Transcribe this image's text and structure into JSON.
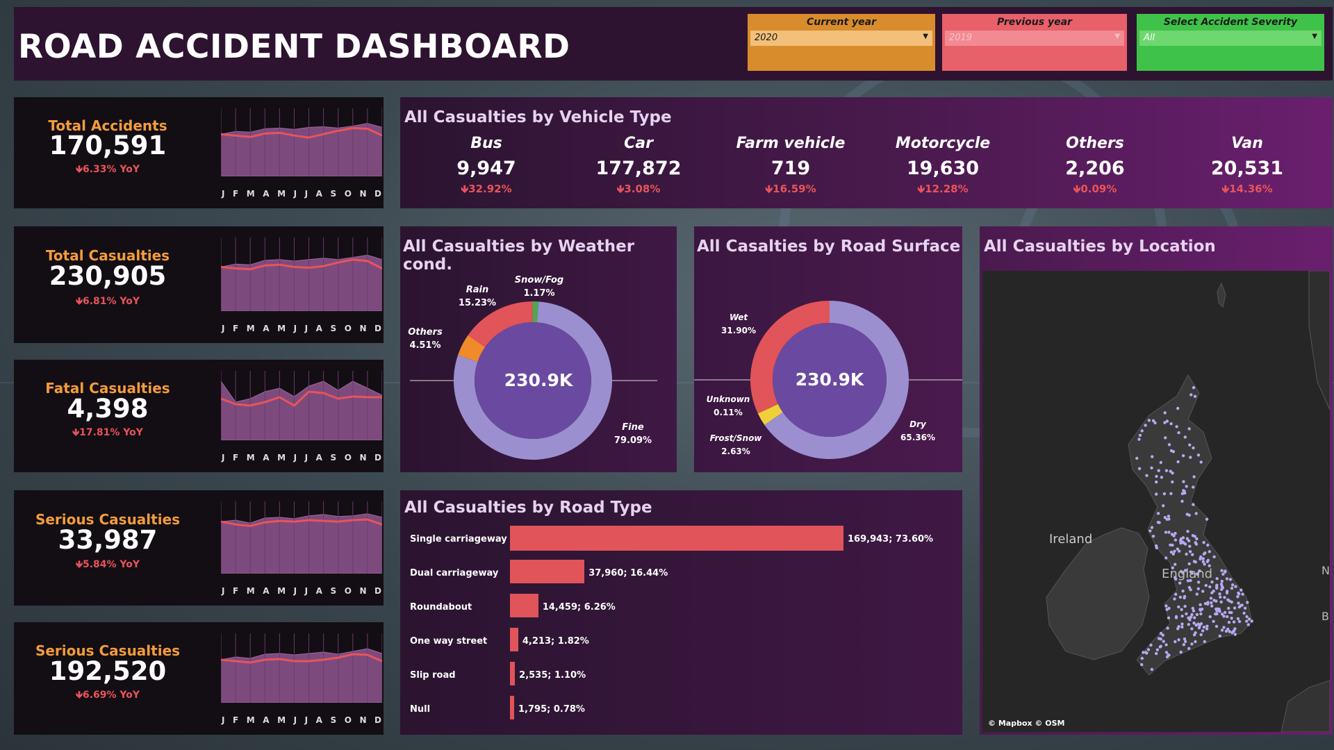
{
  "header": {
    "title": "ROAD ACCIDENT DASHBOARD"
  },
  "filters": [
    {
      "label": "Current year",
      "value": "2020",
      "color": "#d98c2b",
      "selcolor": "#f2c07a"
    },
    {
      "label": "Previous year",
      "value": "2019",
      "color": "#e8606a",
      "selcolor": "#f28a92"
    },
    {
      "label": "Select Accident Severity",
      "value": "All",
      "color": "#3fc24a",
      "selcolor": "#6fd76f"
    }
  ],
  "kpis": [
    {
      "title": "Total Accidents",
      "value": "170,591",
      "yoy": "🡻6.33% YoY",
      "area": [
        0.62,
        0.66,
        0.65,
        0.7,
        0.71,
        0.69,
        0.72,
        0.73,
        0.71,
        0.74,
        0.78,
        0.72
      ],
      "line": [
        0.62,
        0.6,
        0.58,
        0.63,
        0.64,
        0.6,
        0.57,
        0.62,
        0.67,
        0.71,
        0.7,
        0.6
      ]
    },
    {
      "title": "Total Casualties",
      "value": "230,905",
      "yoy": "🡻6.81% YoY",
      "area": [
        0.6,
        0.64,
        0.63,
        0.69,
        0.7,
        0.68,
        0.7,
        0.72,
        0.7,
        0.73,
        0.76,
        0.7
      ],
      "line": [
        0.6,
        0.58,
        0.57,
        0.62,
        0.63,
        0.6,
        0.59,
        0.61,
        0.66,
        0.7,
        0.68,
        0.58
      ]
    },
    {
      "title": "Fatal Casualties",
      "value": "4,398",
      "yoy": "🡻17.81% YoY",
      "area": [
        0.85,
        0.55,
        0.6,
        0.7,
        0.75,
        0.63,
        0.78,
        0.85,
        0.72,
        0.85,
        0.75,
        0.65
      ],
      "line": [
        0.6,
        0.52,
        0.5,
        0.55,
        0.62,
        0.5,
        0.7,
        0.68,
        0.6,
        0.63,
        0.62,
        0.62
      ]
    },
    {
      "title": "Serious Casualties",
      "value": "33,987",
      "yoy": "🡻5.84% YoY",
      "area": [
        0.72,
        0.74,
        0.7,
        0.77,
        0.78,
        0.76,
        0.8,
        0.82,
        0.79,
        0.8,
        0.83,
        0.78
      ],
      "line": [
        0.72,
        0.68,
        0.66,
        0.71,
        0.73,
        0.72,
        0.74,
        0.73,
        0.72,
        0.74,
        0.75,
        0.68
      ]
    },
    {
      "title": "Serious Casualties",
      "value": "192,520",
      "yoy": "🡻6.69% YoY",
      "area": [
        0.62,
        0.66,
        0.64,
        0.7,
        0.71,
        0.69,
        0.71,
        0.73,
        0.7,
        0.74,
        0.78,
        0.71
      ],
      "line": [
        0.62,
        0.6,
        0.58,
        0.62,
        0.63,
        0.6,
        0.6,
        0.62,
        0.65,
        0.7,
        0.69,
        0.6
      ]
    }
  ],
  "months": [
    "J",
    "F",
    "M",
    "A",
    "M",
    "J",
    "J",
    "A",
    "S",
    "O",
    "N",
    "D"
  ],
  "vehicle": {
    "title": "All Casualties by Vehicle Type",
    "items": [
      {
        "name": "Bus",
        "value": "9,947",
        "change": "🡻32.92%"
      },
      {
        "name": "Car",
        "value": "177,872",
        "change": "🡻3.08%"
      },
      {
        "name": "Farm vehicle",
        "value": "719",
        "change": "🡻16.59%"
      },
      {
        "name": "Motorcycle",
        "value": "19,630",
        "change": "🡻12.28%"
      },
      {
        "name": "Others",
        "value": "2,206",
        "change": "🡻0.09%"
      },
      {
        "name": "Van",
        "value": "20,531",
        "change": "🡻14.36%"
      }
    ]
  },
  "weather": {
    "title": "All Casualties by Weather cond.",
    "center": "230.9K",
    "slices": [
      {
        "name": "Fine",
        "pct": "79.09%",
        "value": 79.09,
        "color": "#9b8fd0"
      },
      {
        "name": "Others",
        "pct": "4.51%",
        "value": 4.51,
        "color": "#f08a2a"
      },
      {
        "name": "Rain",
        "pct": "15.23%",
        "value": 15.23,
        "color": "#e0545a"
      },
      {
        "name": "Snow/Fog",
        "pct": "1.17%",
        "value": 1.17,
        "color": "#4fa84f"
      }
    ]
  },
  "surface": {
    "title": "All Casaltiesi by Road Surface",
    "center": "230.9K",
    "slices": [
      {
        "name": "Dry",
        "pct": "65.36%",
        "value": 65.36,
        "color": "#9b8fd0"
      },
      {
        "name": "Frost/Snow",
        "pct": "2.63%",
        "value": 2.63,
        "color": "#f0d03a"
      },
      {
        "name": "Unknown",
        "pct": "0.11%",
        "value": 0.11,
        "color": "#f08a2a"
      },
      {
        "name": "Wet",
        "pct": "31.90%",
        "value": 31.9,
        "color": "#e0545a"
      }
    ]
  },
  "roadtype": {
    "title": "All Casualties by Road Type",
    "rows": [
      {
        "name": "Single carriageway",
        "value": 169943,
        "label": "169,943; 73.60%"
      },
      {
        "name": "Dual carriageway",
        "value": 37960,
        "label": "37,960; 16.44%"
      },
      {
        "name": "Roundabout",
        "value": 14459,
        "label": "14,459; 6.26%"
      },
      {
        "name": "One way street",
        "value": 4213,
        "label": "4,213; 1.82%"
      },
      {
        "name": "Slip road",
        "value": 2535,
        "label": "2,535; 1.10%"
      },
      {
        "name": "Null",
        "value": 1795,
        "label": "1,795; 0.78%"
      }
    ]
  },
  "location": {
    "title": "All Casualties by Location",
    "labels": {
      "ireland": "Ireland",
      "england": "England",
      "n": "N",
      "b": "B"
    },
    "attribution": "© Mapbox  © OSM"
  }
}
